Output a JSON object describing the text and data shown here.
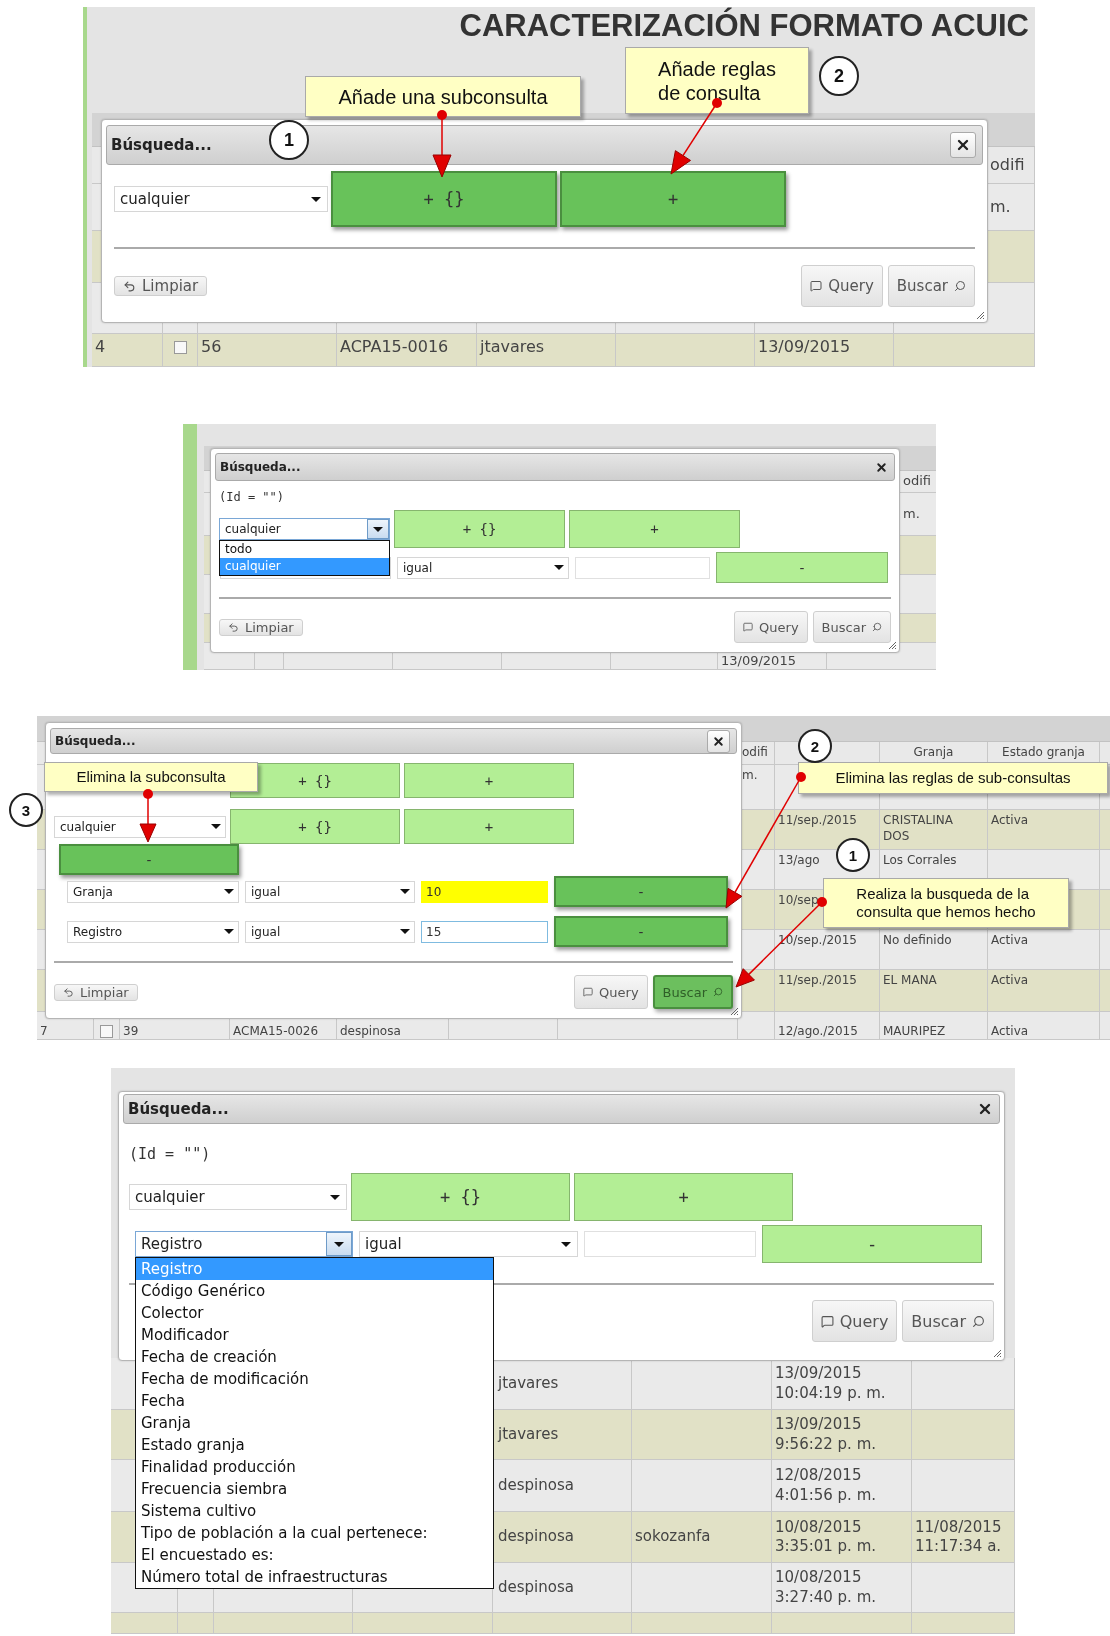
{
  "panels": [
    {
      "page_title": "CARACTERIZACIÓN FORMATO ACUIC",
      "table": {
        "header": [
          "odifi"
        ],
        "rows": [
          {
            "shaded": false,
            "cells": [
              "m."
            ]
          },
          {
            "shaded": true
          },
          {
            "shaded": false
          },
          {
            "shaded": true,
            "cells": [
              "4",
              {
                "kind": "checkbox",
                "checked": false
              },
              "56",
              "ACPA15-0016",
              "jtavares",
              "13/09/2015"
            ]
          }
        ]
      },
      "dialog": {
        "title": "Búsqueda...",
        "close": {
          "framed": true
        },
        "rows": [
          {
            "kind": "group",
            "match": {
              "value": "cualquier"
            },
            "add_group": {
              "label": "+ {}",
              "emphasis": true
            },
            "add_rule": {
              "label": "+",
              "emphasis": true
            }
          }
        ],
        "footer": {
          "clear": "Limpiar",
          "query": "Query",
          "search": {
            "label": "Buscar",
            "emphasis": false
          }
        }
      },
      "callouts": [
        "Añade una subconsulta",
        "Añade reglas\nde consulta"
      ],
      "markers": [
        "1",
        "2"
      ]
    },
    {
      "table": {
        "header": [
          "odifi"
        ],
        "rows": [
          {
            "shaded": false,
            "cells": [
              "m."
            ]
          },
          {
            "shaded": true
          },
          {
            "shaded": false
          },
          {
            "shaded": true
          },
          {
            "shaded": false,
            "cells": [
              "13/09/2015"
            ]
          }
        ]
      },
      "dialog": {
        "title": "Búsqueda...",
        "close": {
          "framed": false
        },
        "query_text": "(Id = \"\")",
        "rows": [
          {
            "kind": "group",
            "match": {
              "value": "cualquier",
              "options": [
                {
                  "label": "todo",
                  "selected": false
                },
                {
                  "label": "cualquier",
                  "selected": true
                }
              ]
            },
            "add_group": {
              "label": "+ {}",
              "emphasis": false
            },
            "add_rule": {
              "label": "+",
              "emphasis": false
            }
          },
          {
            "kind": "rule",
            "operator": {
              "value": "igual"
            },
            "remove": {
              "label": "-",
              "emphasis": false
            }
          }
        ],
        "footer": {
          "clear": "Limpiar",
          "query": "Query",
          "search": {
            "label": "Buscar",
            "emphasis": false
          }
        }
      }
    },
    {
      "table": {
        "header": [
          "odifi",
          "Granja",
          "Estado granja"
        ],
        "rows": [
          {
            "shaded": false,
            "cells": [
              "m."
            ]
          },
          {
            "shaded": true,
            "cells": [
              "11/sep./2015",
              "CRISTALINA\nDOS",
              "Activa"
            ]
          },
          {
            "shaded": false,
            "cells": [
              "13/ago",
              "Los Corrales"
            ]
          },
          {
            "shaded": true,
            "cells": [
              "10/sep"
            ]
          },
          {
            "shaded": false,
            "cells": [
              "10/sep./2015",
              "No definido",
              "Activa"
            ]
          },
          {
            "shaded": true,
            "cells": [
              "11/sep./2015",
              "EL MANA",
              "Activa"
            ]
          },
          {
            "shaded": false,
            "cells": [
              "7",
              {
                "kind": "checkbox",
                "checked": false
              },
              "39",
              "ACMA15-0026",
              "despinosa",
              "12/ago./2015",
              "MAURIPEZ",
              "Activa"
            ]
          }
        ]
      },
      "dialog": {
        "title": "Búsqueda...",
        "close": {
          "framed": true
        },
        "rows": [
          {
            "kind": "group",
            "add_group": {
              "label": "+ {}",
              "emphasis": false
            },
            "add_rule": {
              "label": "+",
              "emphasis": false
            }
          },
          {
            "kind": "group",
            "match": {
              "value": "cualquier"
            },
            "add_group": {
              "label": "+ {}",
              "emphasis": false
            },
            "add_rule": {
              "label": "+",
              "emphasis": false
            }
          },
          {
            "kind": "remove_group",
            "remove": {
              "label": "-",
              "emphasis": true
            }
          },
          {
            "kind": "rule",
            "field": {
              "value": "Granja"
            },
            "operator": {
              "value": "igual"
            },
            "value": {
              "text": "10",
              "highlighted": true,
              "focused": false
            },
            "remove": {
              "label": "-",
              "emphasis": true
            }
          },
          {
            "kind": "rule",
            "field": {
              "value": "Registro"
            },
            "operator": {
              "value": "igual"
            },
            "value": {
              "text": "15",
              "highlighted": false,
              "focused": true
            },
            "remove": {
              "label": "-",
              "emphasis": true
            }
          }
        ],
        "footer": {
          "clear": "Limpiar",
          "query": "Query",
          "search": {
            "label": "Buscar",
            "emphasis": true
          }
        }
      },
      "callouts": [
        "Elimina la subconsulta",
        "Elimina las reglas de sub-consultas",
        "Realiza la busqueda de la\nconsulta que hemos hecho"
      ],
      "markers": [
        "2",
        "3",
        "1"
      ]
    },
    {
      "table": {
        "rows": [
          {
            "shaded": false,
            "cells": [
              "jtavares",
              "13/09/2015\n10:04:19 p. m."
            ]
          },
          {
            "shaded": true,
            "cells": [
              "jtavares",
              "13/09/2015\n9:56:22 p. m."
            ]
          },
          {
            "shaded": false,
            "cells": [
              "despinosa",
              "12/08/2015\n4:01:56 p. m."
            ]
          },
          {
            "shaded": true,
            "cells": [
              "despinosa",
              "sokozanfa",
              "10/08/2015\n3:35:01 p. m.",
              "11/08/2015\n11:17:34 a."
            ]
          },
          {
            "shaded": false,
            "cells": [
              "despinosa",
              "10/08/2015\n3:27:40 p. m."
            ]
          },
          {
            "shaded": true
          }
        ]
      },
      "dialog": {
        "title": "Búsqueda...",
        "close": {
          "framed": false
        },
        "query_text": "(Id = \"\")",
        "rows": [
          {
            "kind": "group",
            "match": {
              "value": "cualquier"
            },
            "add_group": {
              "label": "+ {}",
              "emphasis": false
            },
            "add_rule": {
              "label": "+",
              "emphasis": false
            }
          },
          {
            "kind": "rule",
            "field": {
              "value": "Registro",
              "options": [
                {
                  "label": "Registro",
                  "selected": true
                },
                {
                  "label": "Código Genérico",
                  "selected": false
                },
                {
                  "label": "Colector",
                  "selected": false
                },
                {
                  "label": "Modificador",
                  "selected": false
                },
                {
                  "label": "Fecha de creación",
                  "selected": false
                },
                {
                  "label": "Fecha de modificación",
                  "selected": false
                },
                {
                  "label": "Fecha",
                  "selected": false
                },
                {
                  "label": "Granja",
                  "selected": false
                },
                {
                  "label": "Estado granja",
                  "selected": false
                },
                {
                  "label": "Finalidad producción",
                  "selected": false
                },
                {
                  "label": "Frecuencia siembra",
                  "selected": false
                },
                {
                  "label": "Sistema cultivo",
                  "selected": false
                },
                {
                  "label": "Tipo de población a la cual pertenece:",
                  "selected": false
                },
                {
                  "label": "El encuestado es:",
                  "selected": false
                },
                {
                  "label": "Número total de infraestructuras",
                  "selected": false
                }
              ]
            },
            "operator": {
              "value": "igual"
            },
            "remove": {
              "label": "-",
              "emphasis": false
            }
          }
        ],
        "footer": {
          "query": "Query",
          "search": {
            "label": "Buscar",
            "emphasis": false
          }
        }
      }
    }
  ]
}
